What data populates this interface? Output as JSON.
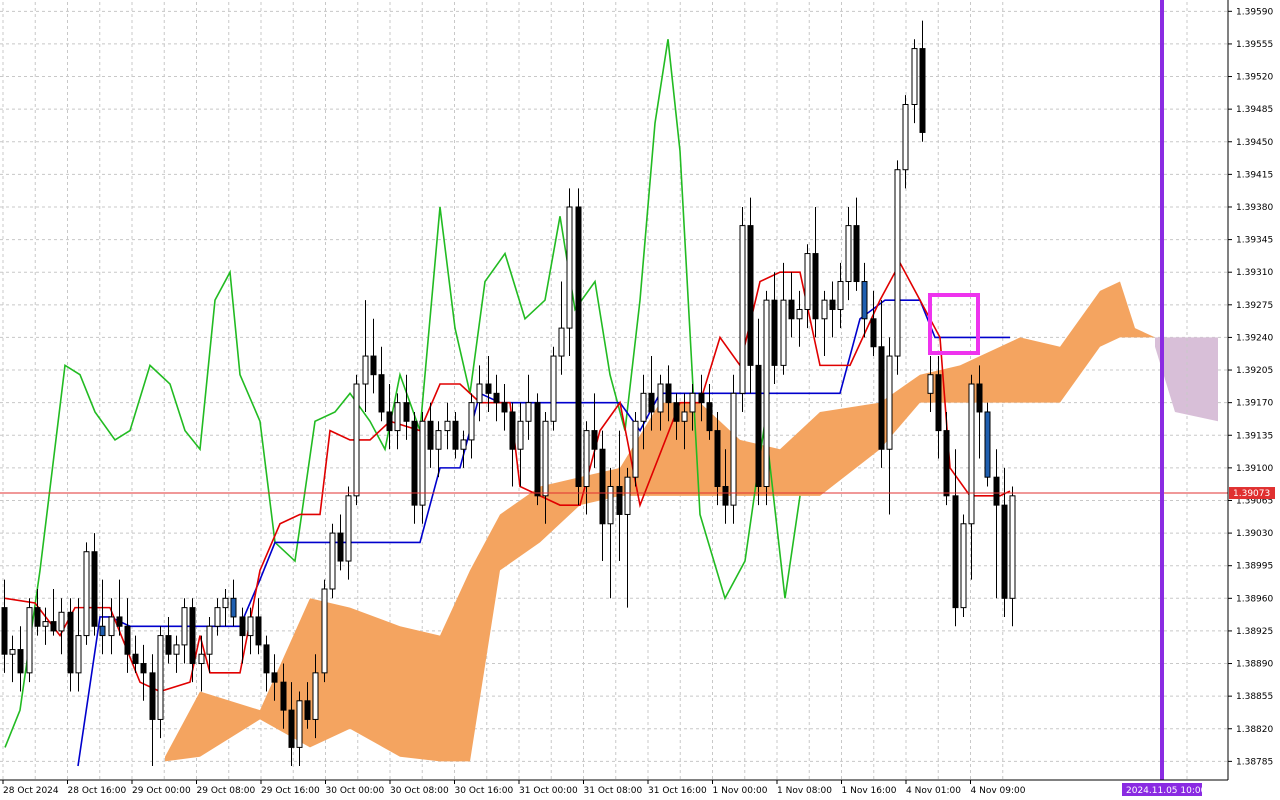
{
  "chart_data": {
    "type": "candlestick",
    "y_ticks": [
      "1.39590",
      "1.39555",
      "1.39520",
      "1.39485",
      "1.39450",
      "1.39415",
      "1.39380",
      "1.39345",
      "1.39310",
      "1.39275",
      "1.39240",
      "1.39205",
      "1.39170",
      "1.39135",
      "1.39100",
      "1.39065",
      "1.39030",
      "1.38995",
      "1.38960",
      "1.38925",
      "1.38890",
      "1.38855",
      "1.38820",
      "1.38785"
    ],
    "ylim": [
      1.38765,
      1.396
    ],
    "x_ticks": [
      "28 Oct 2024",
      "28 Oct 16:00",
      "29 Oct 00:00",
      "29 Oct 08:00",
      "29 Oct 16:00",
      "30 Oct 00:00",
      "30 Oct 08:00",
      "30 Oct 16:00",
      "31 Oct 00:00",
      "31 Oct 08:00",
      "31 Oct 16:00",
      "1 Nov 00:00",
      "1 Nov 08:00",
      "1 Nov 16:00",
      "4 Nov 01:00",
      "4 Nov 09:00"
    ],
    "current_price": "1.39073",
    "current_price_value": 1.39073,
    "cursor_time_label": "2024.11.05 10:00",
    "grid": true,
    "colors": {
      "tenkan": "#e00000",
      "kijun": "#0000cc",
      "chikou": "#22bb22",
      "kumo_bull": "#f4a460",
      "kumo_future": "#d8bfd8",
      "price_line": "#e03030",
      "vertical_marker": "#8a2be2",
      "highlight_box": "#ee33ee",
      "bull_candle": "#ffffff",
      "bear_candle": "#000000",
      "blue_candle": "#1f5fb0"
    },
    "candles": [
      [
        1.3895,
        1.3898,
        1.3888,
        1.389
      ],
      [
        1.389,
        1.3892,
        1.3887,
        1.38905
      ],
      [
        1.38905,
        1.3893,
        1.3886,
        1.3888
      ],
      [
        1.3888,
        1.3896,
        1.3887,
        1.3895
      ],
      [
        1.3895,
        1.3897,
        1.3892,
        1.3893
      ],
      [
        1.3893,
        1.3895,
        1.3891,
        1.38935
      ],
      [
        1.38935,
        1.3897,
        1.3892,
        1.38925
      ],
      [
        1.38925,
        1.3896,
        1.389,
        1.38945
      ],
      [
        1.38945,
        1.3896,
        1.3886,
        1.3888
      ],
      [
        1.3888,
        1.3896,
        1.3886,
        1.3892
      ],
      [
        1.3892,
        1.3902,
        1.3891,
        1.3901
      ],
      [
        1.3901,
        1.3903,
        1.3892,
        1.3893
      ],
      [
        1.3893,
        1.3898,
        1.389,
        1.3892
      ],
      [
        1.3892,
        1.3896,
        1.389,
        1.3894
      ],
      [
        1.3894,
        1.3898,
        1.3892,
        1.3893
      ],
      [
        1.3893,
        1.3896,
        1.3888,
        1.389
      ],
      [
        1.389,
        1.3892,
        1.3888,
        1.3889
      ],
      [
        1.3889,
        1.3891,
        1.3885,
        1.3888
      ],
      [
        1.3888,
        1.389,
        1.3878,
        1.3883
      ],
      [
        1.3883,
        1.3893,
        1.3881,
        1.3892
      ],
      [
        1.3892,
        1.3894,
        1.3889,
        1.389
      ],
      [
        1.389,
        1.3892,
        1.3888,
        1.3891
      ],
      [
        1.3891,
        1.3896,
        1.3889,
        1.3895
      ],
      [
        1.3895,
        1.3896,
        1.3887,
        1.3889
      ],
      [
        1.3889,
        1.3892,
        1.3886,
        1.389
      ],
      [
        1.389,
        1.3894,
        1.3888,
        1.3893
      ],
      [
        1.3893,
        1.3896,
        1.3892,
        1.3895
      ],
      [
        1.3895,
        1.3897,
        1.3893,
        1.3896
      ],
      [
        1.3896,
        1.3898,
        1.3893,
        1.3894
      ],
      [
        1.3894,
        1.3895,
        1.3889,
        1.3892
      ],
      [
        1.3892,
        1.3895,
        1.389,
        1.3894
      ],
      [
        1.3894,
        1.3896,
        1.389,
        1.3891
      ],
      [
        1.3891,
        1.3892,
        1.3886,
        1.3888
      ],
      [
        1.3888,
        1.389,
        1.3885,
        1.3887
      ],
      [
        1.3887,
        1.3889,
        1.3882,
        1.3884
      ],
      [
        1.3884,
        1.3887,
        1.3878,
        1.388
      ],
      [
        1.388,
        1.3886,
        1.3878,
        1.3885
      ],
      [
        1.3885,
        1.3887,
        1.3882,
        1.3883
      ],
      [
        1.3883,
        1.389,
        1.3881,
        1.3888
      ],
      [
        1.3888,
        1.3898,
        1.3887,
        1.3897
      ],
      [
        1.3897,
        1.3904,
        1.3896,
        1.3903
      ],
      [
        1.3903,
        1.3905,
        1.3899,
        1.39
      ],
      [
        1.39,
        1.3908,
        1.3898,
        1.3907
      ],
      [
        1.3907,
        1.392,
        1.3906,
        1.3919
      ],
      [
        1.3919,
        1.3928,
        1.3916,
        1.3922
      ],
      [
        1.3922,
        1.3926,
        1.3918,
        1.392
      ],
      [
        1.392,
        1.3923,
        1.3915,
        1.3916
      ],
      [
        1.3916,
        1.3919,
        1.3912,
        1.3914
      ],
      [
        1.3914,
        1.3918,
        1.3912,
        1.3917
      ],
      [
        1.3917,
        1.392,
        1.3913,
        1.3915
      ],
      [
        1.3915,
        1.3916,
        1.3904,
        1.3906
      ],
      [
        1.3906,
        1.3916,
        1.3904,
        1.3915
      ],
      [
        1.3915,
        1.3917,
        1.391,
        1.3912
      ],
      [
        1.3912,
        1.3915,
        1.3909,
        1.3914
      ],
      [
        1.3914,
        1.3917,
        1.3912,
        1.3915
      ],
      [
        1.3915,
        1.3916,
        1.3911,
        1.3912
      ],
      [
        1.3912,
        1.3914,
        1.391,
        1.3913
      ],
      [
        1.3913,
        1.3918,
        1.3911,
        1.3917
      ],
      [
        1.3917,
        1.3921,
        1.3915,
        1.3919
      ],
      [
        1.3919,
        1.3922,
        1.3916,
        1.3918
      ],
      [
        1.3918,
        1.392,
        1.3915,
        1.3917
      ],
      [
        1.3917,
        1.3919,
        1.3914,
        1.3916
      ],
      [
        1.3916,
        1.3917,
        1.3908,
        1.3912
      ],
      [
        1.3912,
        1.3917,
        1.3908,
        1.3915
      ],
      [
        1.3915,
        1.392,
        1.3913,
        1.3917
      ],
      [
        1.3917,
        1.3918,
        1.3906,
        1.3907
      ],
      [
        1.3907,
        1.3916,
        1.3904,
        1.3915
      ],
      [
        1.3915,
        1.3923,
        1.3914,
        1.3922
      ],
      [
        1.3922,
        1.393,
        1.392,
        1.3925
      ],
      [
        1.3925,
        1.394,
        1.3922,
        1.3938
      ],
      [
        1.3938,
        1.394,
        1.3906,
        1.3908
      ],
      [
        1.3908,
        1.3915,
        1.3905,
        1.3914
      ],
      [
        1.3914,
        1.3918,
        1.391,
        1.3912
      ],
      [
        1.3912,
        1.3914,
        1.39,
        1.3904
      ],
      [
        1.3904,
        1.391,
        1.3896,
        1.3908
      ],
      [
        1.3908,
        1.3914,
        1.39,
        1.3905
      ],
      [
        1.3905,
        1.391,
        1.3895,
        1.3909
      ],
      [
        1.3909,
        1.3916,
        1.3908,
        1.3915
      ],
      [
        1.3915,
        1.392,
        1.3912,
        1.3918
      ],
      [
        1.3918,
        1.3922,
        1.3914,
        1.3916
      ],
      [
        1.3916,
        1.392,
        1.3914,
        1.3919
      ],
      [
        1.3919,
        1.3921,
        1.3915,
        1.3917
      ],
      [
        1.3917,
        1.3918,
        1.3913,
        1.3915
      ],
      [
        1.3915,
        1.3918,
        1.3912,
        1.3916
      ],
      [
        1.3916,
        1.3919,
        1.3914,
        1.3918
      ],
      [
        1.3918,
        1.392,
        1.3915,
        1.3917
      ],
      [
        1.3917,
        1.3919,
        1.3913,
        1.3914
      ],
      [
        1.3914,
        1.3916,
        1.3906,
        1.3908
      ],
      [
        1.3908,
        1.3912,
        1.3904,
        1.3906
      ],
      [
        1.3906,
        1.392,
        1.3904,
        1.3918
      ],
      [
        1.3918,
        1.3938,
        1.3916,
        1.3936
      ],
      [
        1.3936,
        1.3939,
        1.3918,
        1.3921
      ],
      [
        1.3921,
        1.3926,
        1.3906,
        1.3908
      ],
      [
        1.3908,
        1.3929,
        1.3906,
        1.3928
      ],
      [
        1.3928,
        1.3931,
        1.3919,
        1.3921
      ],
      [
        1.3921,
        1.3932,
        1.392,
        1.3928
      ],
      [
        1.3928,
        1.3931,
        1.3924,
        1.3926
      ],
      [
        1.3926,
        1.3929,
        1.3923,
        1.3927
      ],
      [
        1.3927,
        1.3934,
        1.3925,
        1.3933
      ],
      [
        1.3933,
        1.3938,
        1.3924,
        1.3926
      ],
      [
        1.3926,
        1.3929,
        1.3922,
        1.3928
      ],
      [
        1.3928,
        1.393,
        1.3924,
        1.3927
      ],
      [
        1.3927,
        1.3932,
        1.3925,
        1.393
      ],
      [
        1.393,
        1.3938,
        1.3928,
        1.3936
      ],
      [
        1.3936,
        1.3939,
        1.3929,
        1.393
      ],
      [
        1.393,
        1.3932,
        1.3924,
        1.3926
      ],
      [
        1.3926,
        1.3929,
        1.3922,
        1.3923
      ],
      [
        1.3923,
        1.3928,
        1.391,
        1.3912
      ],
      [
        1.3912,
        1.3924,
        1.3905,
        1.3922
      ],
      [
        1.3922,
        1.3943,
        1.392,
        1.3942
      ],
      [
        1.3942,
        1.395,
        1.394,
        1.3949
      ],
      [
        1.3949,
        1.3956,
        1.3947,
        1.3955
      ],
      [
        1.3955,
        1.3958,
        1.3945,
        1.3946
      ],
      [
        1.3918,
        1.3922,
        1.3916,
        1.392
      ],
      [
        1.392,
        1.3922,
        1.3911,
        1.3914
      ],
      [
        1.3914,
        1.3916,
        1.3906,
        1.3907
      ],
      [
        1.3907,
        1.3912,
        1.3893,
        1.3895
      ],
      [
        1.3895,
        1.3905,
        1.3894,
        1.3904
      ],
      [
        1.3904,
        1.392,
        1.3898,
        1.3919
      ],
      [
        1.3919,
        1.3921,
        1.3911,
        1.3916
      ],
      [
        1.3916,
        1.3917,
        1.3908,
        1.3909
      ],
      [
        1.3909,
        1.3912,
        1.3896,
        1.3906
      ],
      [
        1.3906,
        1.391,
        1.3894,
        1.3896
      ],
      [
        1.3896,
        1.3908,
        1.3893,
        1.3907
      ]
    ],
    "kumo": {
      "upper": [
        [
          165,
          1.3879
        ],
        [
          200,
          1.3886
        ],
        [
          260,
          1.3884
        ],
        [
          310,
          1.3896
        ],
        [
          350,
          1.3895
        ],
        [
          400,
          1.3893
        ],
        [
          440,
          1.3892
        ],
        [
          470,
          1.3899
        ],
        [
          500,
          1.3905
        ],
        [
          540,
          1.3908
        ],
        [
          580,
          1.3909
        ],
        [
          620,
          1.391
        ],
        [
          660,
          1.3917
        ],
        [
          700,
          1.3917
        ],
        [
          740,
          1.3913
        ],
        [
          780,
          1.3912
        ],
        [
          820,
          1.3916
        ],
        [
          880,
          1.3917
        ],
        [
          920,
          1.392
        ],
        [
          960,
          1.3921
        ],
        [
          1020,
          1.3924
        ],
        [
          1060,
          1.3923
        ],
        [
          1100,
          1.3929
        ],
        [
          1120,
          1.393
        ],
        [
          1135,
          1.3925
        ],
        [
          1155,
          1.3924
        ]
      ],
      "lower": [
        [
          165,
          1.38785
        ],
        [
          200,
          1.3879
        ],
        [
          260,
          1.3883
        ],
        [
          310,
          1.388
        ],
        [
          350,
          1.3882
        ],
        [
          400,
          1.3879
        ],
        [
          440,
          1.38785
        ],
        [
          470,
          1.38785
        ],
        [
          500,
          1.3899
        ],
        [
          540,
          1.3902
        ],
        [
          580,
          1.3906
        ],
        [
          620,
          1.3907
        ],
        [
          660,
          1.3907
        ],
        [
          700,
          1.3907
        ],
        [
          740,
          1.3907
        ],
        [
          780,
          1.3907
        ],
        [
          820,
          1.3907
        ],
        [
          880,
          1.3912
        ],
        [
          920,
          1.3917
        ],
        [
          960,
          1.3917
        ],
        [
          1020,
          1.3917
        ],
        [
          1060,
          1.3917
        ],
        [
          1100,
          1.3923
        ],
        [
          1120,
          1.3924
        ],
        [
          1135,
          1.3924
        ],
        [
          1155,
          1.3924
        ]
      ]
    },
    "kumo_future": {
      "upper": [
        [
          1155,
          1.3924
        ],
        [
          1218,
          1.3924
        ]
      ],
      "lower": [
        [
          1155,
          1.3923
        ],
        [
          1175,
          1.3916
        ],
        [
          1218,
          1.3915
        ]
      ]
    },
    "tenkan": [
      [
        5,
        1.3896
      ],
      [
        35,
        1.38955
      ],
      [
        60,
        1.3892
      ],
      [
        75,
        1.3895
      ],
      [
        110,
        1.3895
      ],
      [
        140,
        1.3887
      ],
      [
        160,
        1.3886
      ],
      [
        190,
        1.3887
      ],
      [
        200,
        1.3892
      ],
      [
        210,
        1.3888
      ],
      [
        240,
        1.3888
      ],
      [
        260,
        1.3899
      ],
      [
        280,
        1.3904
      ],
      [
        300,
        1.3905
      ],
      [
        320,
        1.3905
      ],
      [
        330,
        1.3914
      ],
      [
        350,
        1.3913
      ],
      [
        370,
        1.3913
      ],
      [
        390,
        1.3915
      ],
      [
        420,
        1.3914
      ],
      [
        440,
        1.3919
      ],
      [
        460,
        1.3919
      ],
      [
        480,
        1.3917
      ],
      [
        510,
        1.3917
      ],
      [
        520,
        1.3908
      ],
      [
        560,
        1.3906
      ],
      [
        580,
        1.3906
      ],
      [
        600,
        1.3914
      ],
      [
        620,
        1.3917
      ],
      [
        640,
        1.3906
      ],
      [
        680,
        1.3917
      ],
      [
        700,
        1.3917
      ],
      [
        720,
        1.3924
      ],
      [
        740,
        1.3921
      ],
      [
        760,
        1.393
      ],
      [
        780,
        1.3931
      ],
      [
        800,
        1.3931
      ],
      [
        820,
        1.3921
      ],
      [
        850,
        1.3921
      ],
      [
        880,
        1.3928
      ],
      [
        900,
        1.3932
      ],
      [
        910,
        1.393
      ],
      [
        920,
        1.3928
      ],
      [
        940,
        1.3924
      ],
      [
        950,
        1.391
      ],
      [
        970,
        1.3907
      ],
      [
        1000,
        1.3907
      ],
      [
        1010,
        1.39075
      ]
    ],
    "kijun": [
      [
        78,
        1.3878
      ],
      [
        100,
        1.3894
      ],
      [
        110,
        1.3894
      ],
      [
        130,
        1.3893
      ],
      [
        200,
        1.3893
      ],
      [
        240,
        1.3893
      ],
      [
        260,
        1.3898
      ],
      [
        275,
        1.3902
      ],
      [
        420,
        1.3902
      ],
      [
        440,
        1.391
      ],
      [
        460,
        1.391
      ],
      [
        480,
        1.3918
      ],
      [
        500,
        1.3917
      ],
      [
        620,
        1.3917
      ],
      [
        640,
        1.3914
      ],
      [
        660,
        1.3918
      ],
      [
        840,
        1.3918
      ],
      [
        860,
        1.3926
      ],
      [
        885,
        1.3928
      ],
      [
        920,
        1.3928
      ],
      [
        935,
        1.3924
      ],
      [
        1010,
        1.3924
      ]
    ],
    "chikou": [
      [
        5,
        1.388
      ],
      [
        20,
        1.3884
      ],
      [
        40,
        1.3899
      ],
      [
        65,
        1.3921
      ],
      [
        80,
        1.392
      ],
      [
        95,
        1.3916
      ],
      [
        115,
        1.3913
      ],
      [
        130,
        1.3914
      ],
      [
        150,
        1.3921
      ],
      [
        170,
        1.3919
      ],
      [
        185,
        1.3914
      ],
      [
        200,
        1.3912
      ],
      [
        215,
        1.3928
      ],
      [
        230,
        1.3931
      ],
      [
        240,
        1.392
      ],
      [
        260,
        1.3915
      ],
      [
        275,
        1.3902
      ],
      [
        295,
        1.39
      ],
      [
        315,
        1.3915
      ],
      [
        335,
        1.3916
      ],
      [
        350,
        1.3918
      ],
      [
        370,
        1.3915
      ],
      [
        385,
        1.3912
      ],
      [
        400,
        1.392
      ],
      [
        420,
        1.3914
      ],
      [
        440,
        1.3938
      ],
      [
        455,
        1.3925
      ],
      [
        470,
        1.3918
      ],
      [
        485,
        1.393
      ],
      [
        505,
        1.3933
      ],
      [
        525,
        1.3926
      ],
      [
        545,
        1.3928
      ],
      [
        560,
        1.3937
      ],
      [
        575,
        1.3927
      ],
      [
        595,
        1.393
      ],
      [
        610,
        1.392
      ],
      [
        625,
        1.3914
      ],
      [
        640,
        1.3928
      ],
      [
        655,
        1.3947
      ],
      [
        668,
        1.3956
      ],
      [
        680,
        1.3944
      ],
      [
        700,
        1.3905
      ],
      [
        725,
        1.3896
      ],
      [
        745,
        1.39
      ],
      [
        765,
        1.3915
      ],
      [
        785,
        1.3896
      ],
      [
        800,
        1.3907
      ]
    ]
  }
}
